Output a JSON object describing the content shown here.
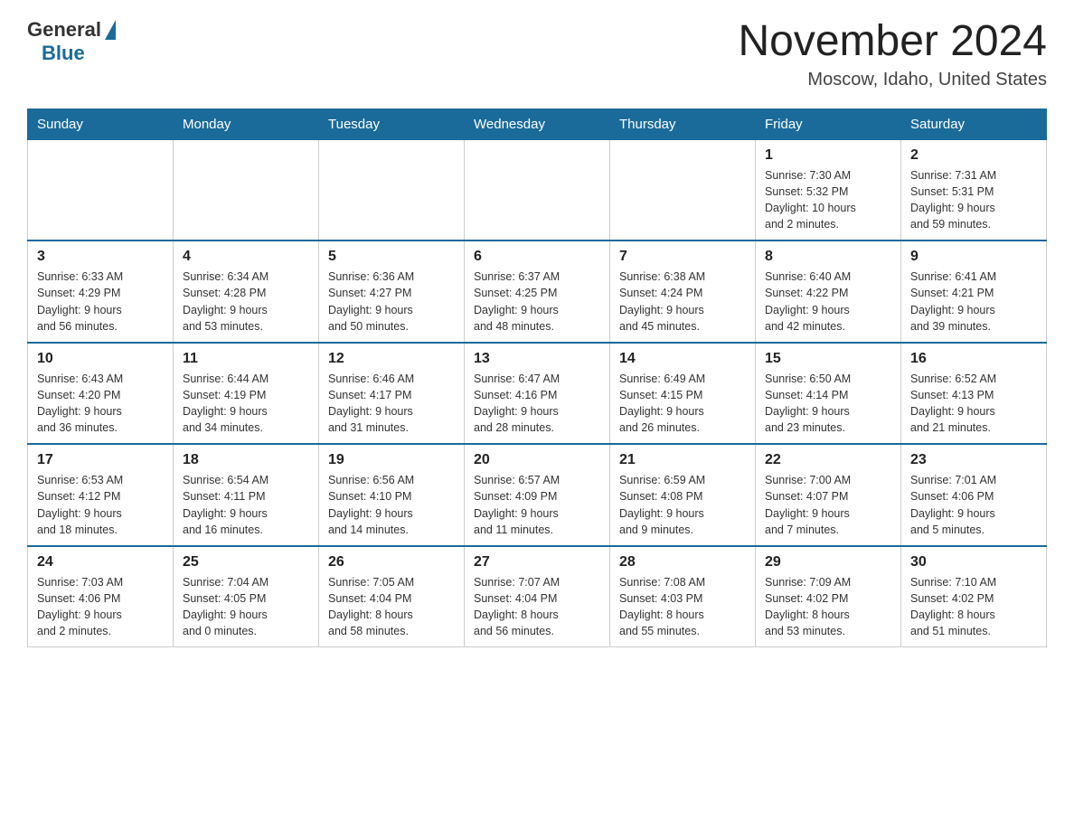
{
  "logo": {
    "general": "General",
    "blue": "Blue"
  },
  "title": {
    "month_year": "November 2024",
    "location": "Moscow, Idaho, United States"
  },
  "weekdays": [
    "Sunday",
    "Monday",
    "Tuesday",
    "Wednesday",
    "Thursday",
    "Friday",
    "Saturday"
  ],
  "weeks": [
    [
      {
        "day": "",
        "info": ""
      },
      {
        "day": "",
        "info": ""
      },
      {
        "day": "",
        "info": ""
      },
      {
        "day": "",
        "info": ""
      },
      {
        "day": "",
        "info": ""
      },
      {
        "day": "1",
        "info": "Sunrise: 7:30 AM\nSunset: 5:32 PM\nDaylight: 10 hours\nand 2 minutes."
      },
      {
        "day": "2",
        "info": "Sunrise: 7:31 AM\nSunset: 5:31 PM\nDaylight: 9 hours\nand 59 minutes."
      }
    ],
    [
      {
        "day": "3",
        "info": "Sunrise: 6:33 AM\nSunset: 4:29 PM\nDaylight: 9 hours\nand 56 minutes."
      },
      {
        "day": "4",
        "info": "Sunrise: 6:34 AM\nSunset: 4:28 PM\nDaylight: 9 hours\nand 53 minutes."
      },
      {
        "day": "5",
        "info": "Sunrise: 6:36 AM\nSunset: 4:27 PM\nDaylight: 9 hours\nand 50 minutes."
      },
      {
        "day": "6",
        "info": "Sunrise: 6:37 AM\nSunset: 4:25 PM\nDaylight: 9 hours\nand 48 minutes."
      },
      {
        "day": "7",
        "info": "Sunrise: 6:38 AM\nSunset: 4:24 PM\nDaylight: 9 hours\nand 45 minutes."
      },
      {
        "day": "8",
        "info": "Sunrise: 6:40 AM\nSunset: 4:22 PM\nDaylight: 9 hours\nand 42 minutes."
      },
      {
        "day": "9",
        "info": "Sunrise: 6:41 AM\nSunset: 4:21 PM\nDaylight: 9 hours\nand 39 minutes."
      }
    ],
    [
      {
        "day": "10",
        "info": "Sunrise: 6:43 AM\nSunset: 4:20 PM\nDaylight: 9 hours\nand 36 minutes."
      },
      {
        "day": "11",
        "info": "Sunrise: 6:44 AM\nSunset: 4:19 PM\nDaylight: 9 hours\nand 34 minutes."
      },
      {
        "day": "12",
        "info": "Sunrise: 6:46 AM\nSunset: 4:17 PM\nDaylight: 9 hours\nand 31 minutes."
      },
      {
        "day": "13",
        "info": "Sunrise: 6:47 AM\nSunset: 4:16 PM\nDaylight: 9 hours\nand 28 minutes."
      },
      {
        "day": "14",
        "info": "Sunrise: 6:49 AM\nSunset: 4:15 PM\nDaylight: 9 hours\nand 26 minutes."
      },
      {
        "day": "15",
        "info": "Sunrise: 6:50 AM\nSunset: 4:14 PM\nDaylight: 9 hours\nand 23 minutes."
      },
      {
        "day": "16",
        "info": "Sunrise: 6:52 AM\nSunset: 4:13 PM\nDaylight: 9 hours\nand 21 minutes."
      }
    ],
    [
      {
        "day": "17",
        "info": "Sunrise: 6:53 AM\nSunset: 4:12 PM\nDaylight: 9 hours\nand 18 minutes."
      },
      {
        "day": "18",
        "info": "Sunrise: 6:54 AM\nSunset: 4:11 PM\nDaylight: 9 hours\nand 16 minutes."
      },
      {
        "day": "19",
        "info": "Sunrise: 6:56 AM\nSunset: 4:10 PM\nDaylight: 9 hours\nand 14 minutes."
      },
      {
        "day": "20",
        "info": "Sunrise: 6:57 AM\nSunset: 4:09 PM\nDaylight: 9 hours\nand 11 minutes."
      },
      {
        "day": "21",
        "info": "Sunrise: 6:59 AM\nSunset: 4:08 PM\nDaylight: 9 hours\nand 9 minutes."
      },
      {
        "day": "22",
        "info": "Sunrise: 7:00 AM\nSunset: 4:07 PM\nDaylight: 9 hours\nand 7 minutes."
      },
      {
        "day": "23",
        "info": "Sunrise: 7:01 AM\nSunset: 4:06 PM\nDaylight: 9 hours\nand 5 minutes."
      }
    ],
    [
      {
        "day": "24",
        "info": "Sunrise: 7:03 AM\nSunset: 4:06 PM\nDaylight: 9 hours\nand 2 minutes."
      },
      {
        "day": "25",
        "info": "Sunrise: 7:04 AM\nSunset: 4:05 PM\nDaylight: 9 hours\nand 0 minutes."
      },
      {
        "day": "26",
        "info": "Sunrise: 7:05 AM\nSunset: 4:04 PM\nDaylight: 8 hours\nand 58 minutes."
      },
      {
        "day": "27",
        "info": "Sunrise: 7:07 AM\nSunset: 4:04 PM\nDaylight: 8 hours\nand 56 minutes."
      },
      {
        "day": "28",
        "info": "Sunrise: 7:08 AM\nSunset: 4:03 PM\nDaylight: 8 hours\nand 55 minutes."
      },
      {
        "day": "29",
        "info": "Sunrise: 7:09 AM\nSunset: 4:02 PM\nDaylight: 8 hours\nand 53 minutes."
      },
      {
        "day": "30",
        "info": "Sunrise: 7:10 AM\nSunset: 4:02 PM\nDaylight: 8 hours\nand 51 minutes."
      }
    ]
  ]
}
